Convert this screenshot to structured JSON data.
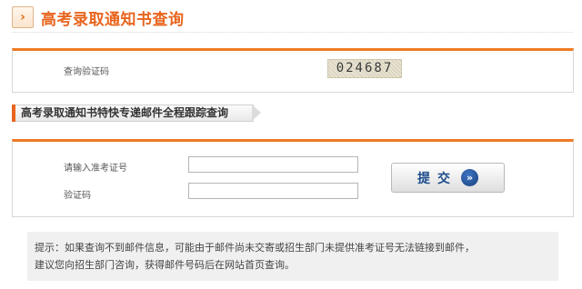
{
  "header": {
    "arrow_glyph": "›",
    "title": "高考录取通知书查询"
  },
  "query_box": {
    "verify_label": "查询验证码",
    "captcha_text": "024687"
  },
  "section": {
    "title": "高考录取通知书特快专递邮件全程跟踪查询"
  },
  "form": {
    "exam_number_label": "请输入准考证号",
    "exam_number_value": "",
    "code_label": "验证码",
    "code_value": "",
    "submit_label": "提交",
    "submit_icon": "»"
  },
  "notice": {
    "line1": "提示：如果查询不到邮件信息，可能由于邮件尚未交寄或招生部门未提供准考证号无法链接到邮件，",
    "line2": "建议您向招生部门咨询，获得邮件号码后在网站首页查询。"
  },
  "colors": {
    "accent_orange": "#e8651e",
    "button_text_blue": "#1b4b8a"
  }
}
